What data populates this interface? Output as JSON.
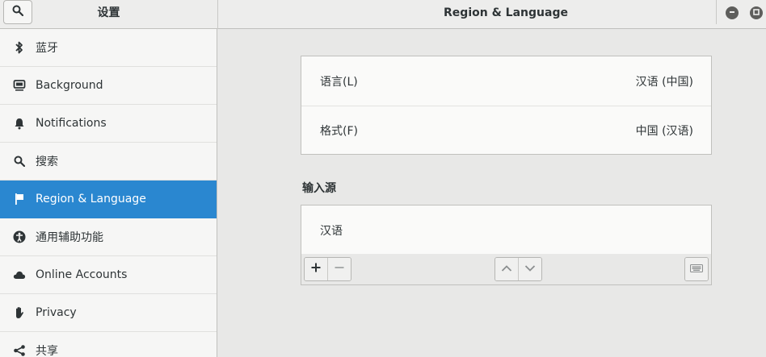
{
  "header": {
    "sidebar_title": "设置",
    "main_title": "Region & Language"
  },
  "sidebar": {
    "items": [
      {
        "label": "蓝牙",
        "icon": "bluetooth-icon"
      },
      {
        "label": "Background",
        "icon": "background-icon"
      },
      {
        "label": "Notifications",
        "icon": "bell-icon"
      },
      {
        "label": "搜索",
        "icon": "search-icon"
      },
      {
        "label": "Region & Language",
        "icon": "flag-icon",
        "active": true
      },
      {
        "label": "通用辅助功能",
        "icon": "accessibility-icon"
      },
      {
        "label": "Online Accounts",
        "icon": "cloud-icon"
      },
      {
        "label": "Privacy",
        "icon": "hand-icon"
      },
      {
        "label": "共享",
        "icon": "share-icon"
      }
    ]
  },
  "language_card": {
    "language_label": "语言(L)",
    "language_value": "汉语 (中国)",
    "formats_label": "格式(F)",
    "formats_value": "中国 (汉语)"
  },
  "input_sources": {
    "section_label": "输入源",
    "items": [
      "汉语"
    ]
  },
  "colors": {
    "accent": "#2a87d0",
    "sidebar_bg": "#f6f6f5",
    "main_bg": "#e8e8e7"
  }
}
